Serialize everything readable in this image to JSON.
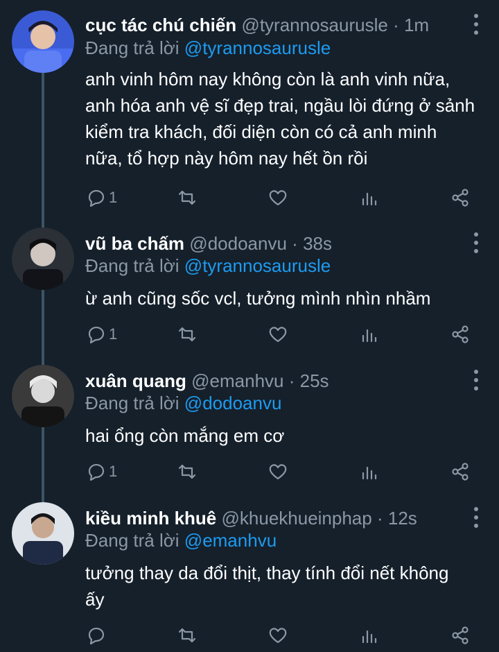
{
  "reply_prefix": "Đang trả lời",
  "tweets": [
    {
      "name": "cục tác chú chiến",
      "handle": "@tyrannosaurusle",
      "time": "1m",
      "reply_to": "@tyrannosaurusle",
      "text_lines": [
        "anh vinh hôm nay không còn là anh vinh nữa,",
        "anh hóa anh vệ sĩ đẹp trai, ngầu lòi đứng ở sảnh",
        "kiểm tra khách, đối diện còn có cả anh minh",
        "nữa, tổ hợp này hôm nay hết ồn rồi"
      ],
      "reply_count": "1",
      "avatar_color": "#3b5bd6"
    },
    {
      "name": "vũ ba chấm",
      "handle": "@dodoanvu",
      "time": "38s",
      "reply_to": "@tyrannosaurusle",
      "text_lines": [
        "ừ anh cũng sốc vcl, tưởng mình nhìn nhầm"
      ],
      "reply_count": "1",
      "avatar_color": "#2b2f36"
    },
    {
      "name": "xuân quang",
      "handle": "@emanhvu",
      "time": "25s",
      "reply_to": "@dodoanvu",
      "text_lines": [
        "hai ổng còn mắng em cơ"
      ],
      "reply_count": "1",
      "avatar_color": "#3a3a3a"
    },
    {
      "name": "kiều minh khuê",
      "handle": "@khuekhueinphap",
      "time": "12s",
      "reply_to": "@emanhvu",
      "text_lines": [
        "tưởng thay da đổi thịt, thay tính đổi nết không",
        "ấy"
      ],
      "reply_count": "",
      "avatar_color": "#1f2a44"
    }
  ]
}
